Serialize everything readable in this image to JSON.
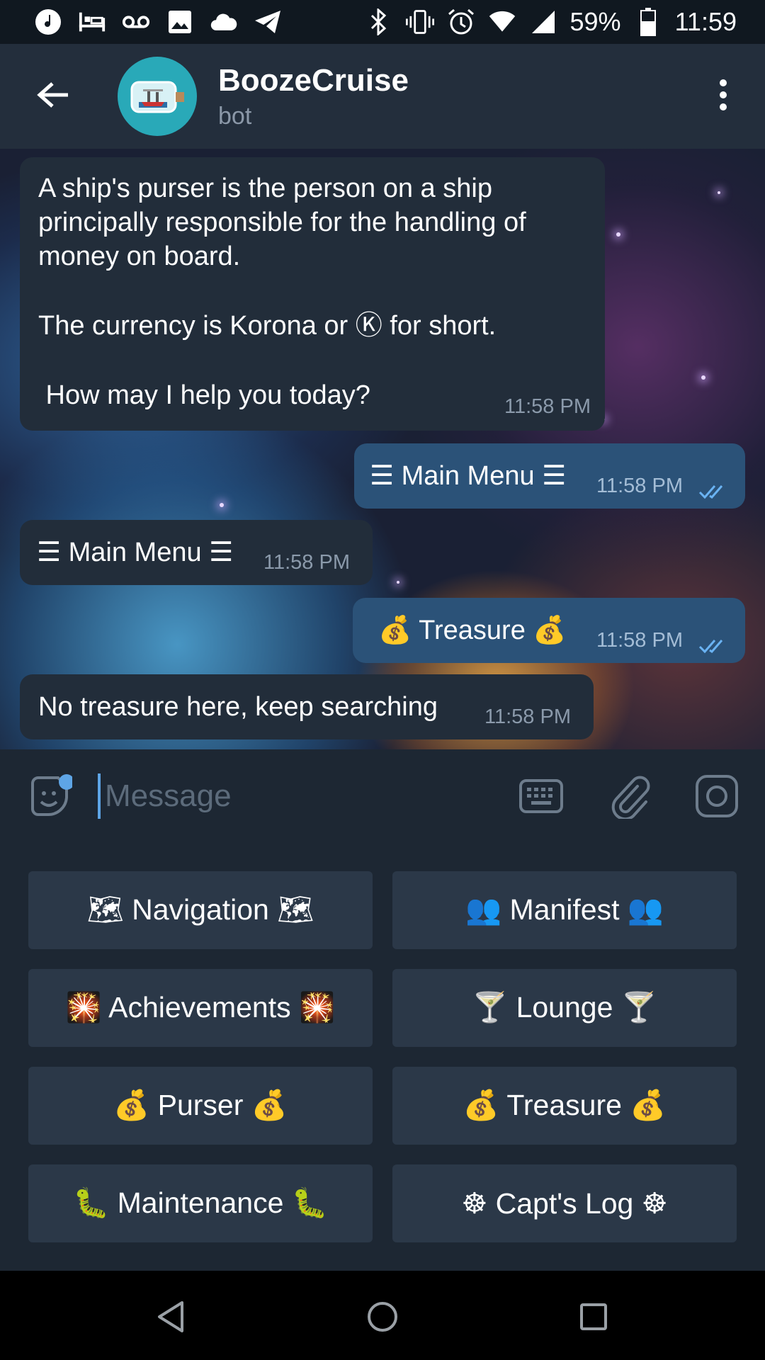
{
  "status_bar": {
    "battery": "59%",
    "time": "11:59",
    "left_icons": [
      "music-note-icon",
      "bed-icon",
      "voicemail-icon",
      "image-icon",
      "cloud-icon",
      "telegram-icon"
    ],
    "right_icons": [
      "bluetooth-icon",
      "vibrate-icon",
      "alarm-icon",
      "wifi-icon",
      "signal-icon",
      "battery-icon"
    ]
  },
  "header": {
    "title": "BoozeCruise",
    "subtitle": "bot",
    "avatar_color": "#29a9b8"
  },
  "messages": [
    {
      "direction": "in",
      "lines": [
        "A ship's purser is the person on a ship",
        "principally responsible for the handling of",
        "money on board.",
        "",
        "The currency is Korona or Ⓚ for short.",
        "",
        " How may I help you today?"
      ],
      "time": "11:58 PM"
    },
    {
      "direction": "out",
      "text": "☰ Main Menu ☰",
      "time": "11:58 PM",
      "read": true
    },
    {
      "direction": "in",
      "text": "☰ Main Menu ☰",
      "time": "11:58 PM"
    },
    {
      "direction": "out",
      "text": "💰 Treasure 💰",
      "time": "11:58 PM",
      "read": true
    },
    {
      "direction": "in",
      "text": "No treasure here, keep searching",
      "time": "11:58 PM"
    }
  ],
  "input": {
    "placeholder": "Message"
  },
  "keyboard": {
    "buttons": [
      "🗺 Navigation 🗺",
      "👥 Manifest 👥",
      "🎇 Achievements 🎇",
      "🍸 Lounge 🍸",
      "💰 Purser 💰",
      "💰 Treasure 💰",
      "🐛 Maintenance 🐛",
      "☸ Capt's Log ☸"
    ]
  },
  "colors": {
    "header_bg": "#232e3c",
    "incoming_bubble": "#222d3a",
    "outgoing_bubble": "#2b5278",
    "keyboard_button": "#2b3848",
    "accent": "#5ea5e6"
  }
}
